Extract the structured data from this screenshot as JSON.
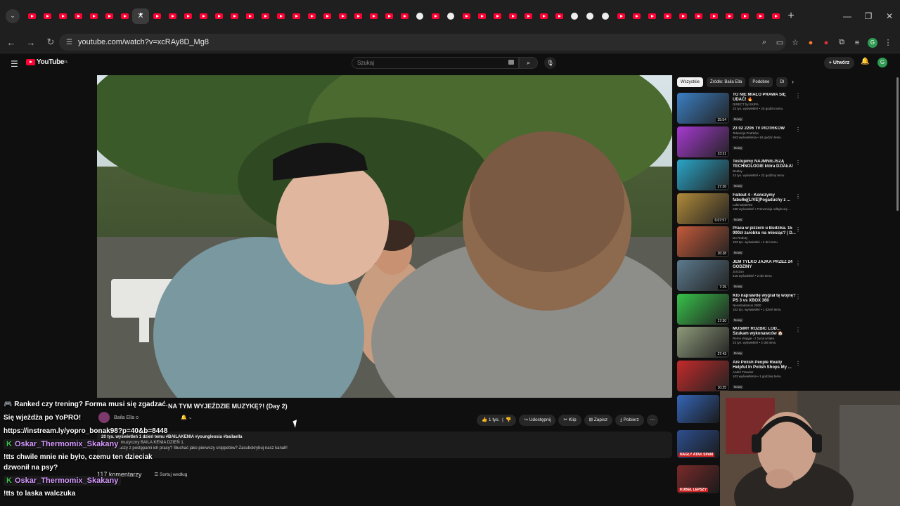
{
  "browser": {
    "url": "youtube.com/watch?v=xcRAy8D_Mg8"
  },
  "header": {
    "logo": "YouTube",
    "logo_country": "PL",
    "search_placeholder": "Szukaj",
    "create_label": "Utwórz",
    "avatar_letter": "G"
  },
  "video": {
    "title": "NA TYM WYJEŹDZIE MUZYKĘ?! (Day 2)",
    "channel": "Baila Ella",
    "channel_sub": "o",
    "likes": "1 tys.",
    "share": "Udostępnij",
    "clip": "Klip",
    "save": "Zapisz",
    "download": "Pobierz",
    "desc_meta": "20 tys. wyświetleń  1 dzień temu  #BAILAKENIA #youngleosia #bailaella",
    "desc_line1": "ny projekt muzyczny BAILA KENIA DZIEŃ 1.",
    "desc_line2": "ić na biedaczy z postępami ich pracy? Słuchać jako pierwszy snippetów? Zasubskrybuj nasz kanał!!",
    "comments_count": "117 komentarzy",
    "sort_label": "Sortuj według"
  },
  "chips": [
    "Wszystkie",
    "Źródło: Baila Ella",
    "Podobne",
    "Dl"
  ],
  "recommendations": [
    {
      "title": "TO NIE MIAŁO PRAWA SIĘ UDAĆ! 🔥",
      "channel": "DIRECT by EKIPA",
      "meta": "23 tys. wyświetleń • 20 godzin temu",
      "badge": "Nowy",
      "duration": "25:54",
      "color": "#3b7fc4"
    },
    {
      "title": "23 02 2206 TV PIOTRKOW",
      "channel": "Telewizja Piotrków",
      "meta": "563 wyświetlenia • 18 godzin temu",
      "badge": "Nowy",
      "duration": "23:31",
      "color": "#a63ad1"
    },
    {
      "title": "Testujemy NAJMNIEJSZĄ TECHNOLOGIE która DZIAŁA!",
      "channel": "Dealsy",
      "meta": "22 tys. wyświetleń • 22 godziny temu",
      "badge": "Nowy",
      "duration": "27:36",
      "color": "#2aa6c9"
    },
    {
      "title": "Fallout 4 - Kończymy fabułkę[LIVE]Pogaduchy z ...",
      "channel": "Lukimaister93",
      "meta": "189 wyświetleń • Transmisja odbyła się ...",
      "badge": "Nowy",
      "duration": "6:07:57",
      "color": "#b08a3a"
    },
    {
      "title": "Praca w pizzerii u Budzika. 15 000zł zarobku na miesiąc? | D...",
      "channel": "Do Roboty",
      "meta": "103 tys. wyświetleń • 2 dni temu",
      "badge": "Nowy",
      "duration": "26:38",
      "color": "#c45a3a"
    },
    {
      "title": "JEM TYLKO JAJKA PRZEZ 24 GODZINY",
      "channel": "Jurczon",
      "meta": "516 wyświetleń • 2 dni temu",
      "badge": "Nowy",
      "duration": "7:25",
      "color": "#5c7a8e"
    },
    {
      "title": "Kto naprawdę wygrał tę wojnę? PS 3 vs XBOX 360",
      "channel": "Neostradamus 2000",
      "meta": "102 tys. wyświetleń • 1 dzień temu",
      "badge": "Nowy",
      "duration": "17:30",
      "color": "#37c24a"
    },
    {
      "title": "MUSIMY ROZBIĆ LÓD... Szukam wykonawców 🏠",
      "channel": "Remo vlogује - z życia wzięte.",
      "meta": "23 tys. wyświetleń • 2 dni temu",
      "badge": "Nowy",
      "duration": "27:43",
      "color": "#8e9a7a"
    },
    {
      "title": "Are Polish People Really Helpful In Polish Shops My ...",
      "channel": "André Traveler",
      "meta": "103 wyświetlenia • 1 godzinę temu",
      "badge": "Nowy",
      "duration": "10:25",
      "color": "#c42a2a"
    }
  ],
  "extra_thumbs": [
    {
      "color": "#3566b8"
    },
    {
      "color": "#2d4f8f",
      "caption": "NAGŁY ATAK SPAM"
    },
    {
      "color": "#7a2a2a",
      "caption": "KUBEŁ LEPSZY"
    }
  ],
  "chat": [
    {
      "text": "🎮 Ranked czy trening? Forma musi się zgadzać."
    },
    {
      "text": "Się wjeżdża po YoPRO!"
    },
    {
      "text": "https://instream.ly/yopro_bonak98?p=40&b=8448"
    },
    {
      "user": "Oskar_Thermomix_Skakany"
    },
    {
      "text": "!tts chwile mnie nie było, czemu ten dzieciak dzwonił na psy?"
    },
    {
      "user": "Oskar_Thermomix_Skakany"
    },
    {
      "text": "!tts to laska walczuka"
    }
  ]
}
